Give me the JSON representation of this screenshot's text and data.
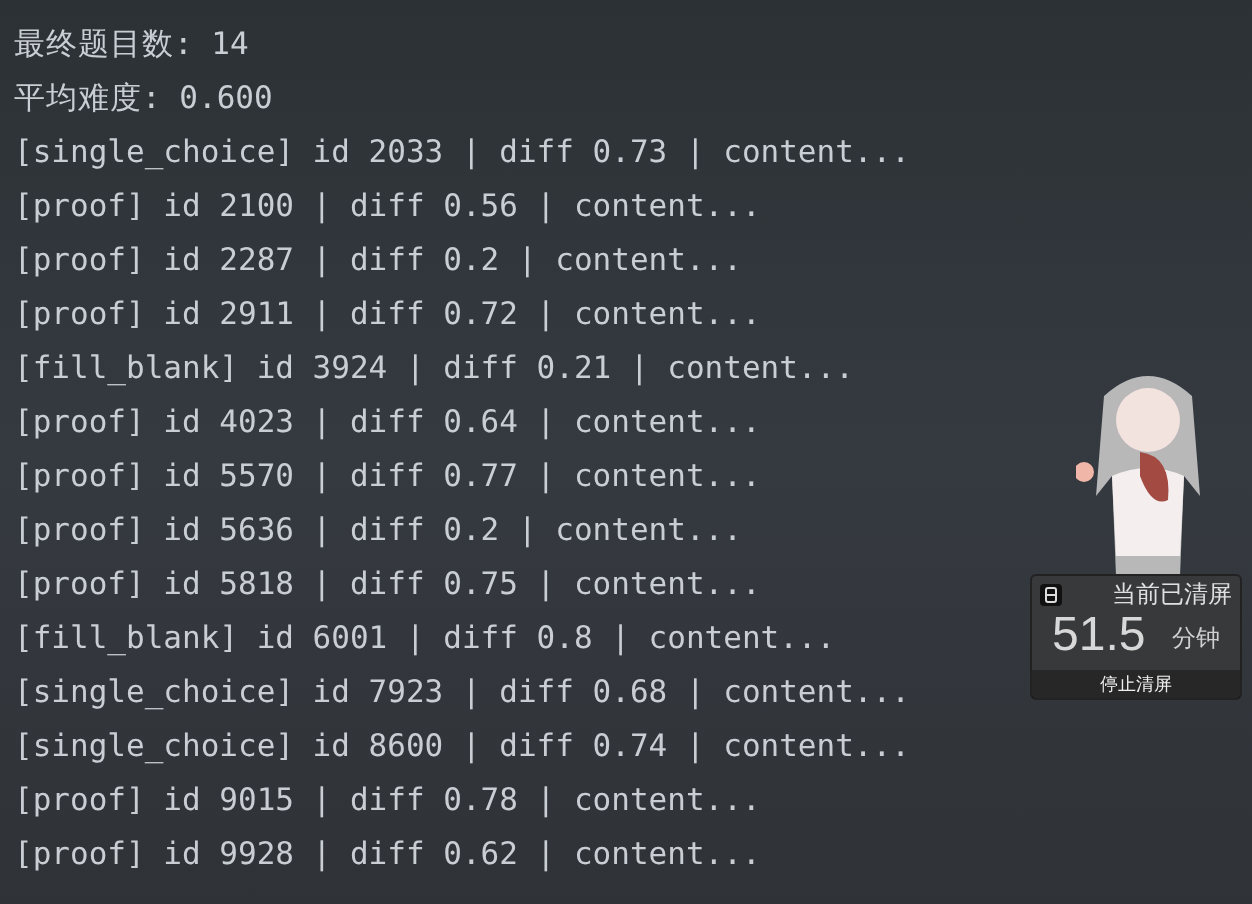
{
  "console_lines": [
    "最终题目数: 14",
    "平均难度: 0.600",
    "[single_choice] id 2033 | diff 0.73 | content...",
    "[proof] id 2100 | diff 0.56 | content...",
    "[proof] id 2287 | diff 0.2 | content...",
    "[proof] id 2911 | diff 0.72 | content...",
    "[fill_blank] id 3924 | diff 0.21 | content...",
    "[proof] id 4023 | diff 0.64 | content...",
    "[proof] id 5570 | diff 0.77 | content...",
    "[proof] id 5636 | diff 0.2 | content...",
    "[proof] id 5818 | diff 0.75 | content...",
    "[fill_blank] id 6001 | diff 0.8 | content...",
    "[single_choice] id 7923 | diff 0.68 | content...",
    "[single_choice] id 8600 | diff 0.74 | content...",
    "[proof] id 9015 | diff 0.78 | content...",
    "[proof] id 9928 | diff 0.62 | content..."
  ],
  "widget": {
    "status": "当前已清屏",
    "value": "51.5",
    "unit": "分钟",
    "button": "停止清屏"
  }
}
